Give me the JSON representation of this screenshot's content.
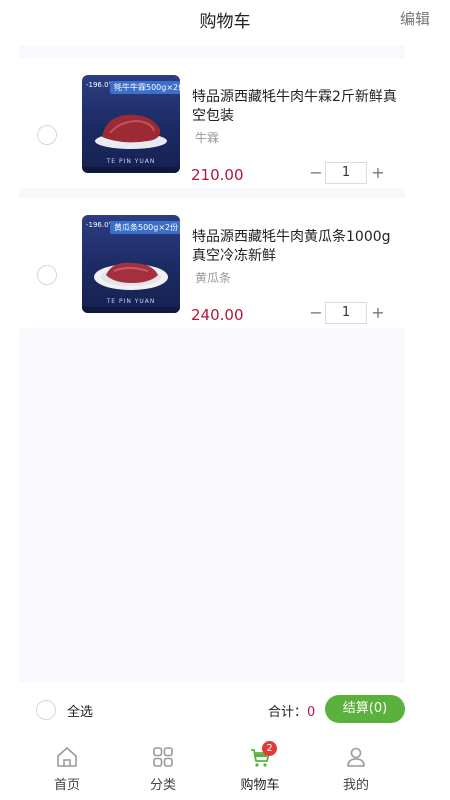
{
  "header": {
    "title": "购物车",
    "edit_label": "编辑"
  },
  "cart": {
    "items": [
      {
        "name": "特品源西藏牦牛肉牛霖2斤新鲜真空包装",
        "spec": "牛霖",
        "price": "210.00",
        "quantity": "1",
        "thumb_badge": "-196.0°C 液氮冷冻",
        "thumb_tag": "牦牛牛霖500g×2份",
        "thumb_brand": "TE PIN YUAN",
        "thumb_icon": "beef-cut-image"
      },
      {
        "name": "特品源西藏牦牛肉黄瓜条1000g真空冷冻新鲜",
        "spec": "黄瓜条",
        "price": "240.00",
        "quantity": "1",
        "thumb_badge": "-196.0°C 液氮冷冻",
        "thumb_tag": "黄瓜条500g×2份",
        "thumb_brand": "TE PIN YUAN",
        "thumb_icon": "beef-plate-image"
      }
    ],
    "minus_symbol": "−",
    "plus_symbol": "+"
  },
  "footer": {
    "select_all_label": "全选",
    "total_label": "合计：",
    "total_value": "0",
    "checkout_label": "结算(0)"
  },
  "tabbar": {
    "items": [
      {
        "label": "首页",
        "icon": "home-icon"
      },
      {
        "label": "分类",
        "icon": "category-grid-icon"
      },
      {
        "label": "购物车",
        "icon": "cart-icon",
        "badge": "2"
      },
      {
        "label": "我的",
        "icon": "profile-icon"
      }
    ]
  },
  "colors": {
    "accent_green": "#5ab23c",
    "price_red": "#b3163c",
    "badge_red": "#e03a3a",
    "content_bg": "#f8f8fd"
  }
}
